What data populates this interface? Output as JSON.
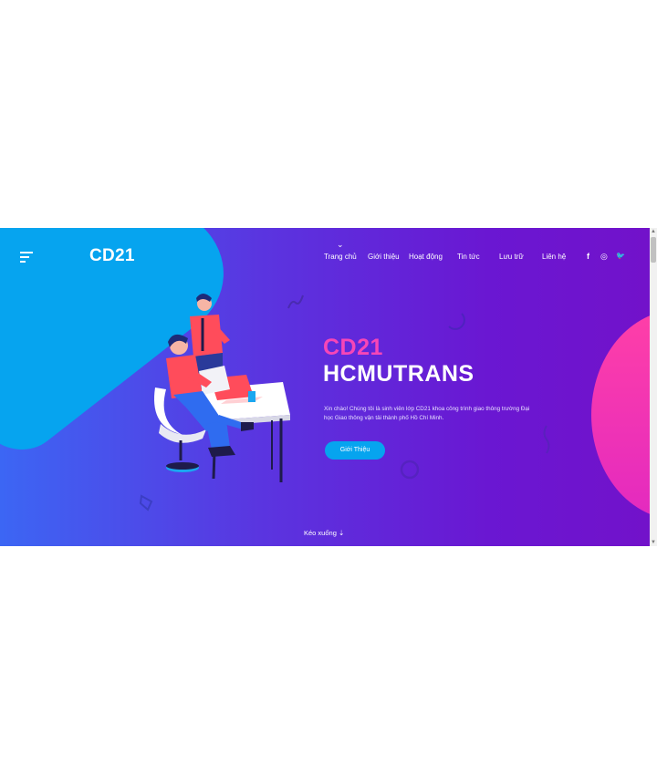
{
  "brand": {
    "logo": "CD21"
  },
  "nav": {
    "chevron": "⌄",
    "items": [
      {
        "label": "Trang chủ"
      },
      {
        "label": "Giới thiệu"
      },
      {
        "label": "Hoạt động"
      },
      {
        "label": "Tin tức"
      },
      {
        "label": "Lưu trữ"
      },
      {
        "label": "Liên hệ"
      }
    ]
  },
  "social": {
    "facebook": "f",
    "instagram": "◎",
    "twitter": "🐦"
  },
  "hero": {
    "title_accent": "CD21",
    "title_main": "HCMUTRANS",
    "description": "Xin chào! Chúng tôi là sinh viên lớp CD21 khoa công trình giao thông trường Đại học Giao thông vận tải thành phố Hồ Chí Minh.",
    "button_label": "Giới Thiệu",
    "scroll_hint": "Kéo xuống ⇣"
  },
  "colors": {
    "gradient_start": "#3c66f4",
    "gradient_end": "#7212ca",
    "accent_blue": "#06a4ef",
    "accent_pink": "#f646b7"
  }
}
